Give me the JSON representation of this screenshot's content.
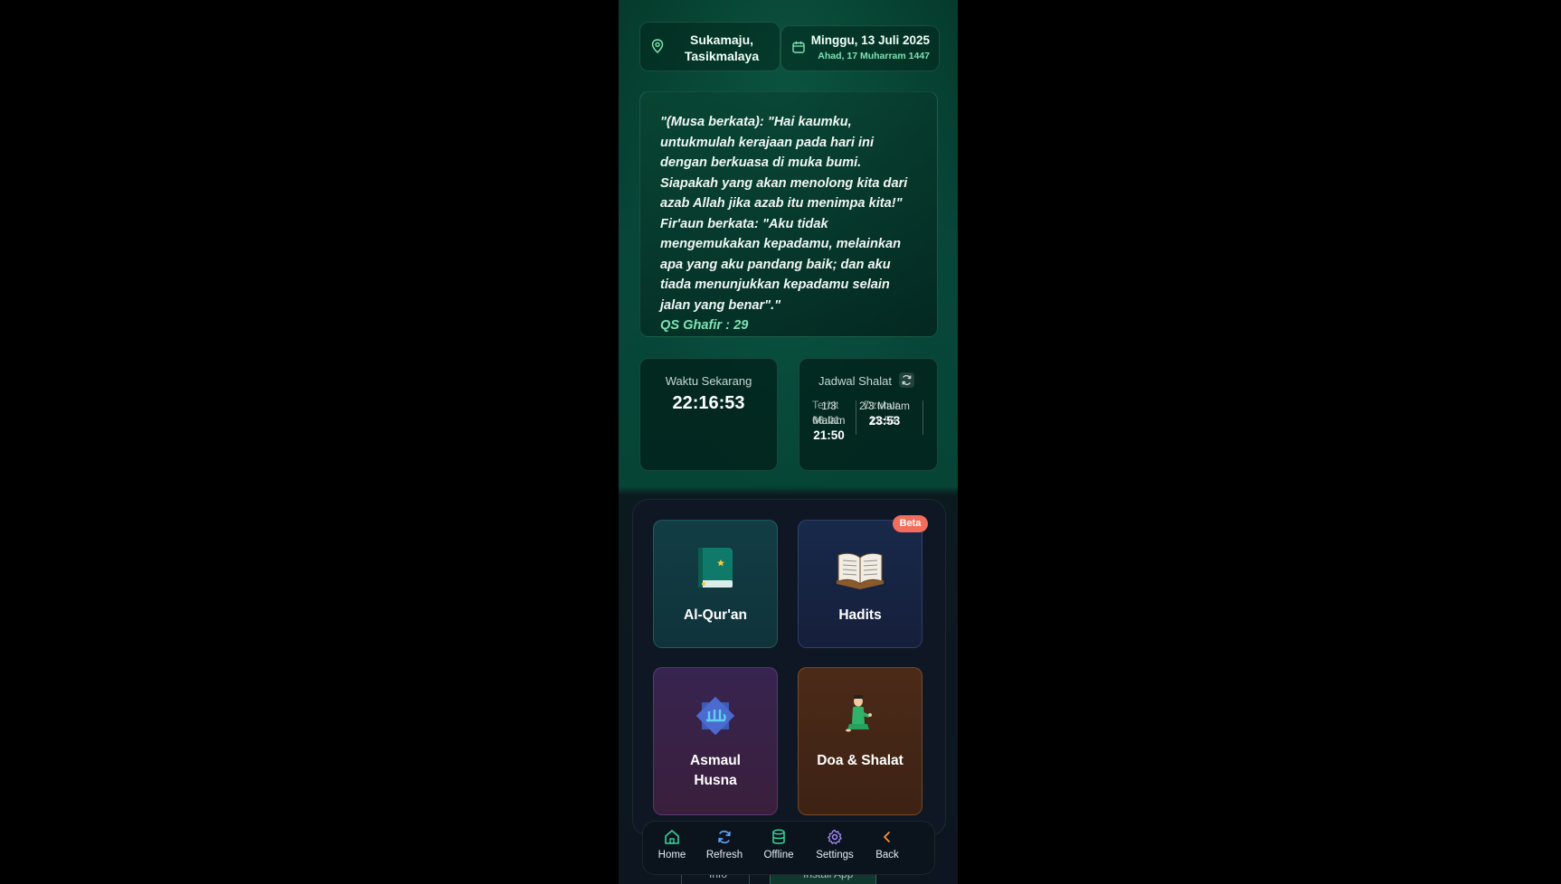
{
  "header": {
    "location": "Sukamaju, Tasikmalaya",
    "date_gregorian": "Minggu, 13 Juli 2025",
    "date_hijri": "Ahad, 17 Muharram 1447"
  },
  "quote": {
    "text": "\"(Musa berkata): \"Hai kaumku, untukmulah kerajaan pada hari ini dengan berkuasa di muka bumi. Siapakah yang akan menolong kita dari azab Allah jika azab itu menimpa kita!\" Fir'aun berkata: \"Aku tidak mengemukakan kepadamu, melainkan apa yang aku pandang baik; dan aku tiada menunjukkan kepadamu selain jalan yang benar\".\"",
    "source": "QS Ghafir : 29"
  },
  "current_time": {
    "label": "Waktu Sekarang",
    "value": "22:16:53"
  },
  "schedule": {
    "label": "Jadwal Shalat",
    "items": [
      {
        "name": "1/3 Malam",
        "time": "21:50"
      },
      {
        "name": "2/3 Malam",
        "time": "23:53"
      }
    ],
    "ghost_items": [
      {
        "name": "Terbit",
        "time": "06:01"
      },
      {
        "name": "Dzuhur",
        "time": "11:53"
      }
    ]
  },
  "menu": {
    "badge": "Beta",
    "tiles": [
      {
        "label": "Al-Qur'an"
      },
      {
        "label": "Hadits"
      },
      {
        "label": "Asmaul Husna"
      },
      {
        "label": "Doa & Shalat"
      }
    ]
  },
  "peek": {
    "info": "Info",
    "install": "Install App"
  },
  "nav": [
    {
      "label": "Home",
      "icon": "home-icon",
      "color": "#34d399"
    },
    {
      "label": "Refresh",
      "icon": "refresh-icon",
      "color": "#60a5fa"
    },
    {
      "label": "Offline",
      "icon": "database-icon",
      "color": "#34d399"
    },
    {
      "label": "Settings",
      "icon": "gear-icon",
      "color": "#a78bfa"
    },
    {
      "label": "Back",
      "icon": "chevron-left-icon",
      "color": "#fb923c"
    }
  ]
}
